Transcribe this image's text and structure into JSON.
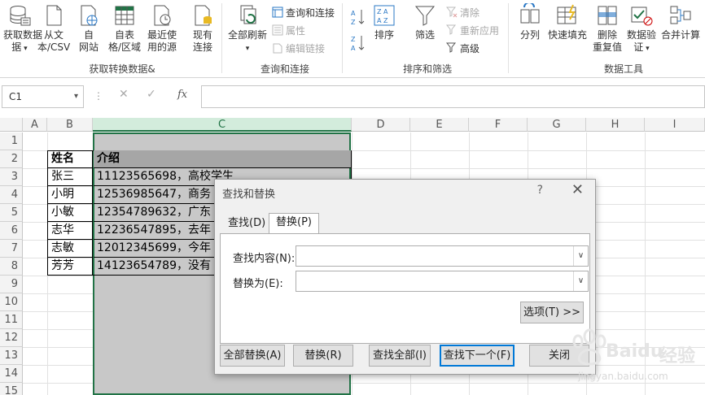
{
  "ribbon": {
    "get_data": {
      "btn1": "获取数据",
      "btn1b": "据",
      "btn2a": "从文",
      "btn2b": "本/CSV",
      "btn3a": "自",
      "btn3b": "网站",
      "btn4a": "自表",
      "btn4b": "格/区域",
      "btn5a": "最近使",
      "btn5b": "用的源",
      "btn6a": "现有",
      "btn6b": "连接",
      "label": "获取转换数据&"
    },
    "queries": {
      "refresh_all": "全部刷新",
      "queries_conn": "查询和连接",
      "properties": "属性",
      "edit_links": "编辑链接",
      "label": "查询和连接"
    },
    "sort_filter": {
      "sort": "排序",
      "filter": "筛选",
      "clear": "清除",
      "reapply": "重新应用",
      "advanced": "高级",
      "label": "排序和筛选"
    },
    "data_tools": {
      "split": "分列",
      "flash_fill": "快速填充",
      "remove_dup_a": "删除",
      "remove_dup_b": "重复值",
      "validation_a": "数据验",
      "validation_b": "证",
      "consolidate": "合并计算",
      "label": "数据工具"
    }
  },
  "formula_bar": {
    "name_box": "C1",
    "fx": "fx",
    "formula": ""
  },
  "grid": {
    "columns": [
      "A",
      "B",
      "C",
      "D",
      "E",
      "F",
      "G",
      "H",
      "I"
    ],
    "rows": [
      "1",
      "2",
      "3",
      "4",
      "5",
      "6",
      "7",
      "8",
      "9",
      "10",
      "11",
      "12",
      "13",
      "14",
      "15"
    ],
    "header_name": "姓名",
    "header_intro": "介绍",
    "names": [
      "张三",
      "小明",
      "小敏",
      "志华",
      "志敏",
      "芳芳"
    ],
    "intros": [
      "11123565698，高校学生",
      "12536985647，商务",
      "12354789632，广东",
      "12236547895，去年",
      "12012345699，今年",
      "14123654789，没有"
    ]
  },
  "dialog": {
    "title": "查找和替换",
    "help": "?",
    "close": "✕",
    "tab_find": "查找(D)",
    "tab_replace": "替换(P)",
    "find_label": "查找内容(N):",
    "replace_label": "替换为(E):",
    "find_value": "",
    "replace_value": "",
    "options_btn": "选项(T) >>",
    "replace_all": "全部替换(A)",
    "replace": "替换(R)",
    "find_all": "查找全部(I)",
    "find_next": "查找下一个(F)",
    "close_btn": "关闭"
  },
  "watermark": {
    "brand": "Baidu",
    "brand2": "经验",
    "url": "jingyan.baidu.com"
  }
}
